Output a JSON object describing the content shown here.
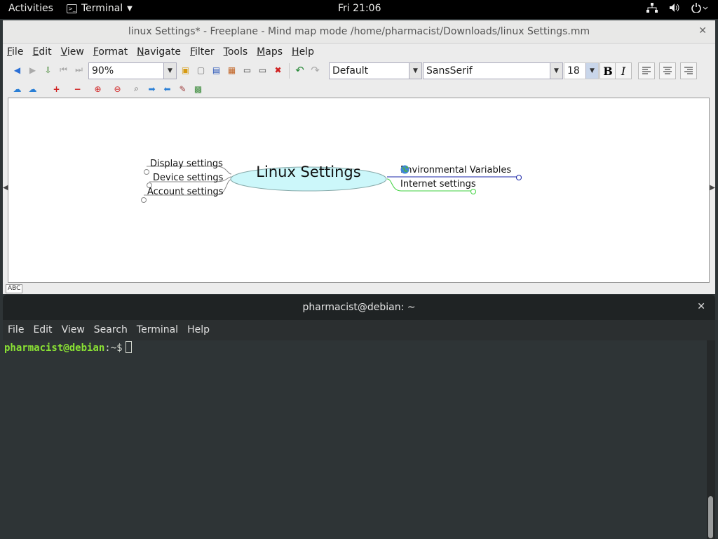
{
  "topbar": {
    "activities": "Activities",
    "app_name": "Terminal",
    "clock": "Fri 21:06",
    "tray_icons": [
      "network-icon",
      "volume-icon",
      "power-icon"
    ]
  },
  "freeplane": {
    "title": "linux Settings* - Freeplane - Mind map mode /home/pharmacist/Downloads/linux Settings.mm",
    "menu": [
      "File",
      "Edit",
      "View",
      "Format",
      "Navigate",
      "Filter",
      "Tools",
      "Maps",
      "Help"
    ],
    "toolbar": {
      "zoom": "90%",
      "style": "Default",
      "font": "SansSerif",
      "font_size": "18",
      "bold": "B",
      "italic": "I"
    },
    "mindmap": {
      "root": "Linux Settings",
      "left_nodes": [
        "Display settings",
        "Device settings",
        "Account settings"
      ],
      "right_nodes": [
        "Environmental Variables",
        "Internet settings"
      ],
      "colors": {
        "root_fill": "#ccf7fa",
        "env_edge": "#1e2aa8",
        "internet_edge": "#3fd23f"
      }
    },
    "status_abc": "ABC"
  },
  "terminal": {
    "title": "pharmacist@debian: ~",
    "menu": [
      "File",
      "Edit",
      "View",
      "Search",
      "Terminal",
      "Help"
    ],
    "prompt_user": "pharmacist@debian",
    "prompt_path": ":~$"
  }
}
